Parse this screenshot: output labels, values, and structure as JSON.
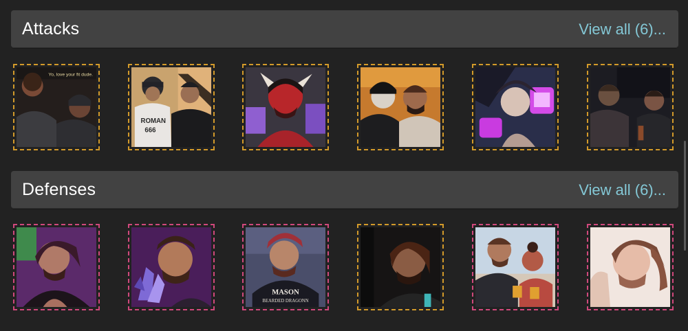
{
  "sections": [
    {
      "title": "Attacks",
      "view_all": "View all (6)...",
      "items": [
        {
          "icon": "comic-dialogue-artwork",
          "border": "#d39a2a",
          "caption_lines": [
            "Yo, love your fit dude."
          ]
        },
        {
          "icon": "hooded-duo-artwork",
          "border": "#d39a2a",
          "caption_lines": [
            "ROMAN",
            "666"
          ]
        },
        {
          "icon": "demon-portrait-artwork",
          "border": "#d39a2a",
          "caption_lines": []
        },
        {
          "icon": "duo-selfie-artwork",
          "border": "#d39a2a",
          "caption_lines": []
        },
        {
          "icon": "neon-character-artwork",
          "border": "#d39a2a",
          "caption_lines": []
        },
        {
          "icon": "comic-scene-artwork",
          "border": "#d39a2a",
          "caption_lines": []
        }
      ]
    },
    {
      "title": "Defenses",
      "view_all": "View all (6)...",
      "items": [
        {
          "icon": "purple-portrait-artwork",
          "border": "#d0487c",
          "caption_lines": []
        },
        {
          "icon": "crystal-portrait-artwork",
          "border": "#d0487c",
          "caption_lines": []
        },
        {
          "icon": "mason-portrait-artwork",
          "border": "#d0487c",
          "caption_lines": [
            "MASON",
            "BEARDED DRAGONN"
          ]
        },
        {
          "icon": "dark-portrait-artwork",
          "border": "#d39a2a",
          "caption_lines": []
        },
        {
          "icon": "duo-drinks-artwork",
          "border": "#d0487c",
          "caption_lines": []
        },
        {
          "icon": "sketch-portrait-artwork",
          "border": "#d0487c",
          "caption_lines": []
        }
      ]
    }
  ]
}
